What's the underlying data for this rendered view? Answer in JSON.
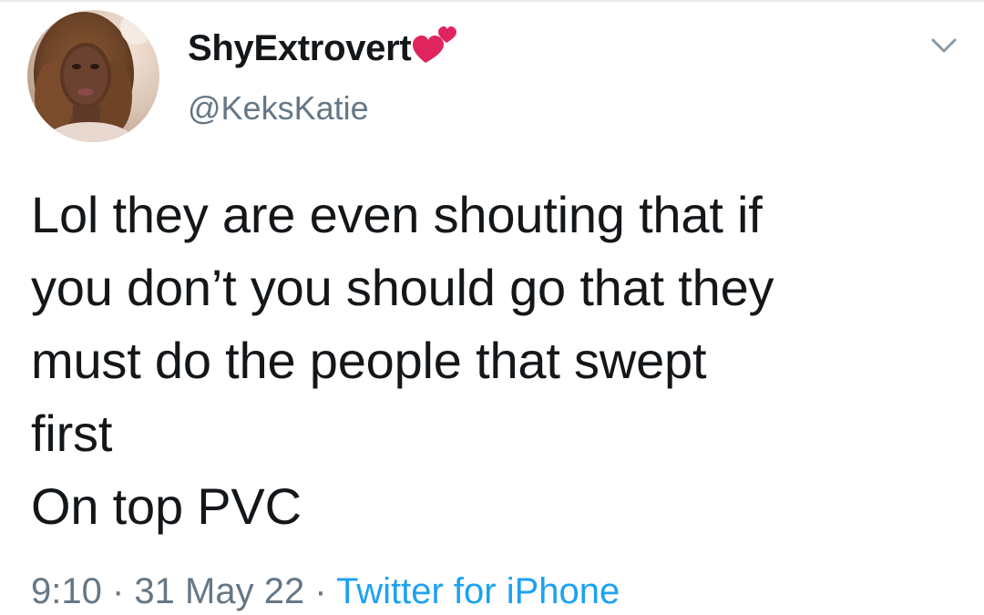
{
  "tweet": {
    "author": {
      "display_name": "ShyExtrovert",
      "name_emoji": "two-hearts-icon",
      "handle": "@KeksKatie",
      "avatar": "profile-photo"
    },
    "text_lines": [
      "Lol they are even shouting that if",
      "you don’t you should go that they",
      "must do the people that swept",
      "first",
      "On top PVC"
    ],
    "meta": {
      "time": "9:10",
      "separator": " · ",
      "date": "31 May 22",
      "source": "Twitter for iPhone"
    },
    "menu_icon": "chevron-down-icon"
  },
  "colors": {
    "text_primary": "#14171a",
    "text_secondary": "#657786",
    "link": "#1da1f2",
    "heart": "#e0245e"
  }
}
